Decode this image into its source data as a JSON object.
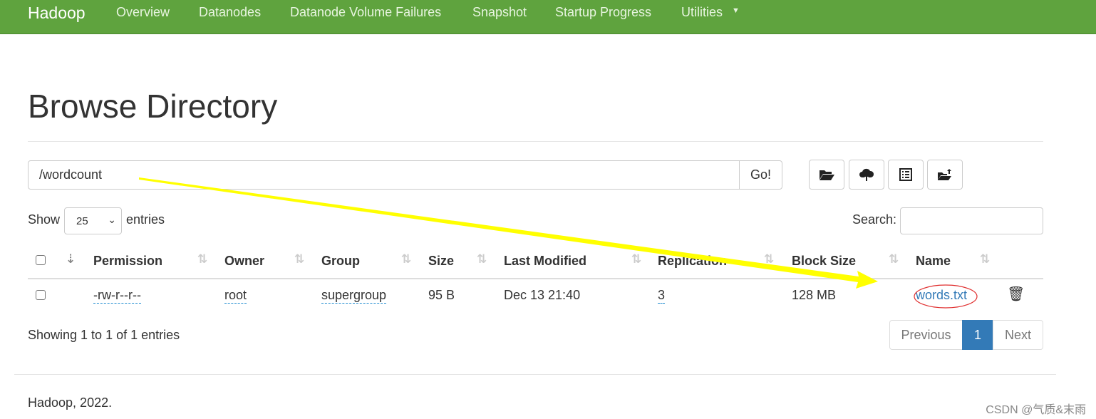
{
  "nav": {
    "brand": "Hadoop",
    "items": [
      "Overview",
      "Datanodes",
      "Datanode Volume Failures",
      "Snapshot",
      "Startup Progress",
      "Utilities"
    ]
  },
  "page_title": "Browse Directory",
  "path_input": {
    "value": "/wordcount"
  },
  "go_label": "Go!",
  "toolbar": {
    "icons": [
      "folder-open-icon",
      "cloud-upload-icon",
      "list-icon",
      "folder-upload-icon"
    ]
  },
  "entries": {
    "show_label": "Show",
    "selected": "25",
    "suffix": "entries"
  },
  "search_label": "Search:",
  "table": {
    "headers": [
      "Permission",
      "Owner",
      "Group",
      "Size",
      "Last Modified",
      "Replication",
      "Block Size",
      "Name"
    ],
    "rows": [
      {
        "permission": "-rw-r--r--",
        "owner": "root",
        "group": "supergroup",
        "size": "95 B",
        "modified": "Dec 13 21:40",
        "replication": "3",
        "block_size": "128 MB",
        "name": "words.txt"
      }
    ]
  },
  "info": "Showing 1 to 1 of 1 entries",
  "pagination": {
    "previous": "Previous",
    "current": "1",
    "next": "Next"
  },
  "footer": "Hadoop, 2022.",
  "watermark": "CSDN @气质&末雨",
  "colors": {
    "navbar": "#5fa33e",
    "link": "#337ab7",
    "active_page": "#337ab7",
    "annotation_arrow": "#ffff00",
    "annotation_circle": "#e03030"
  }
}
